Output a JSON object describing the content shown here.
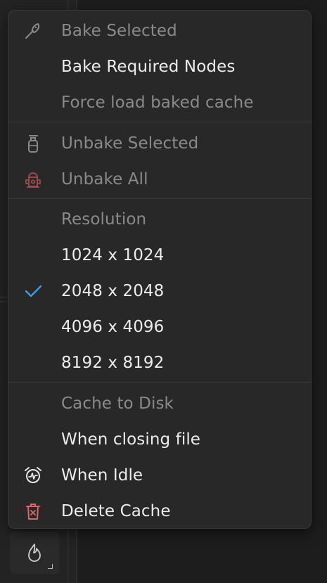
{
  "menu": {
    "bake_section": {
      "bake_selected": "Bake Selected",
      "bake_required": "Bake Required Nodes",
      "force_load": "Force load baked cache"
    },
    "unbake_section": {
      "unbake_selected": "Unbake Selected",
      "unbake_all": "Unbake All"
    },
    "resolution_section": {
      "header": "Resolution",
      "options": [
        "1024 x 1024",
        "2048 x 2048",
        "4096 x 4096",
        "8192 x 8192"
      ],
      "selected": "2048 x 2048"
    },
    "cache_section": {
      "header": "Cache to Disk",
      "when_closing": "When closing file",
      "when_idle": "When Idle",
      "delete_cache": "Delete Cache"
    }
  },
  "icons": {
    "bake_selected": "brush-icon",
    "unbake_selected": "extinguisher-icon",
    "unbake_all": "hydrant-icon",
    "selected_resolution": "checkmark-icon",
    "when_idle": "alarm-clock-icon",
    "delete_cache": "trash-icon",
    "bottom_tool": "flame-icon"
  },
  "colors": {
    "accent_check": "#3d9be9",
    "danger_icon": "#d46a6a",
    "unbake_all_icon": "#9a4a4a",
    "enabled_text": "#ececec",
    "disabled_text": "#8a8a8a"
  }
}
